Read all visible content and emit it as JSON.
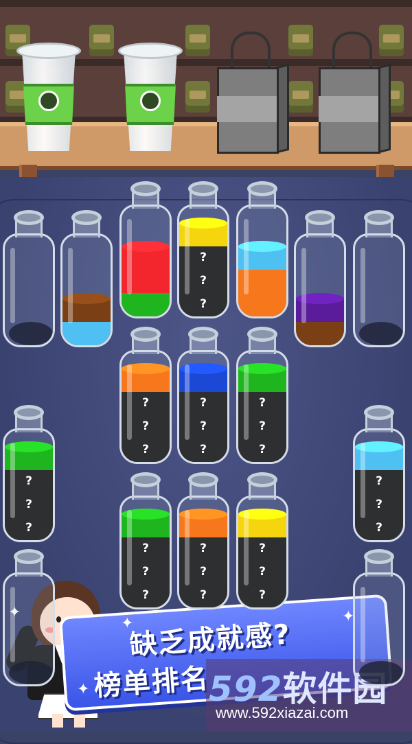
{
  "colors": {
    "red": "#f2262c",
    "green": "#1fb51f",
    "yellow": "#f5d60e",
    "skyblue": "#4fc0f2",
    "orange": "#f7781c",
    "brown": "#7a3f14",
    "purple": "#5a1c9a",
    "blue": "#1c48d6",
    "hidden": "#2e2f31",
    "board": "#3a4270",
    "banner": "#4a62f0"
  },
  "shelf": {
    "cups": [
      {
        "icon": "matcha-bowl-icon"
      },
      {
        "icon": "matcha-bowl-icon"
      }
    ],
    "bags": [
      {
        "icon": "shopping-bag-icon"
      },
      {
        "icon": "shopping-bag-icon"
      }
    ]
  },
  "bottles": [
    {
      "id": "b1",
      "layers": []
    },
    {
      "id": "b2",
      "layers": [
        "skyblue",
        "brown"
      ]
    },
    {
      "id": "b3",
      "layers": [
        "green",
        "red",
        "red"
      ]
    },
    {
      "id": "b4",
      "layers": [
        "hidden",
        "hidden",
        "hidden",
        "yellow"
      ]
    },
    {
      "id": "b5",
      "layers": [
        "orange",
        "orange",
        "skyblue"
      ]
    },
    {
      "id": "b6",
      "layers": [
        "brown",
        "purple"
      ]
    },
    {
      "id": "b7",
      "layers": []
    },
    {
      "id": "b8",
      "layers": [
        "hidden",
        "hidden",
        "hidden",
        "orange"
      ]
    },
    {
      "id": "b9",
      "layers": [
        "hidden",
        "hidden",
        "hidden",
        "blue"
      ]
    },
    {
      "id": "b10",
      "layers": [
        "hidden",
        "hidden",
        "hidden",
        "green"
      ]
    },
    {
      "id": "b11",
      "layers": [
        "hidden",
        "hidden",
        "hidden",
        "green"
      ]
    },
    {
      "id": "b12",
      "layers": [
        "hidden",
        "hidden",
        "hidden",
        "skyblue"
      ]
    },
    {
      "id": "b13",
      "layers": [
        "hidden",
        "hidden",
        "hidden",
        "green"
      ]
    },
    {
      "id": "b14",
      "layers": [
        "hidden",
        "hidden",
        "hidden",
        "orange"
      ]
    },
    {
      "id": "b15",
      "layers": [
        "hidden",
        "hidden",
        "hidden",
        "yellow"
      ]
    },
    {
      "id": "b16",
      "layers": []
    },
    {
      "id": "b17",
      "layers": []
    }
  ],
  "hidden_mark": "?",
  "banner": {
    "line1": "缺乏成就感?",
    "line2": "榜单排名"
  },
  "watermark": {
    "brand_num": "592",
    "brand_text": "软件园",
    "url": "www.592xiazai.com"
  }
}
